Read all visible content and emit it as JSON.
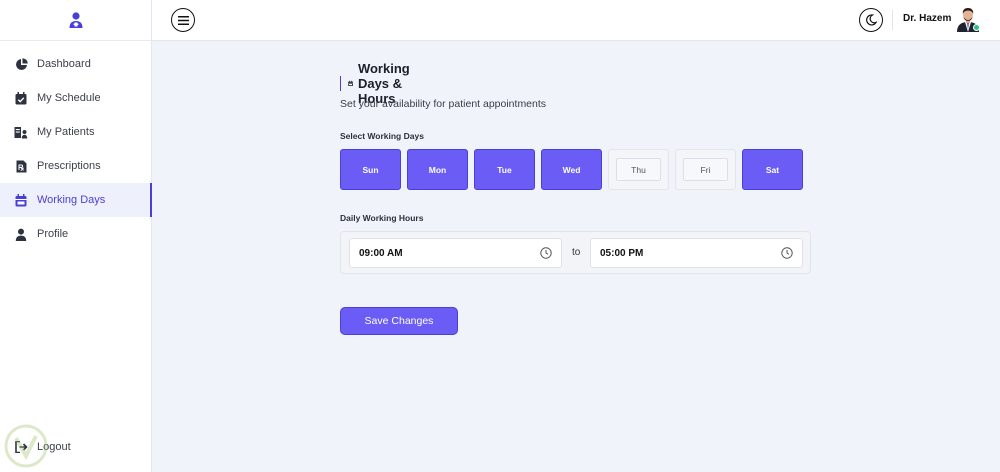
{
  "sidebar": {
    "items": [
      {
        "label": "Dashboard",
        "icon": "pie-chart-icon"
      },
      {
        "label": "My Schedule",
        "icon": "calendar-check-icon"
      },
      {
        "label": "My Patients",
        "icon": "patients-icon"
      },
      {
        "label": "Prescriptions",
        "icon": "prescription-icon"
      },
      {
        "label": "Working Days",
        "icon": "calendar-icon",
        "active": true
      },
      {
        "label": "Profile",
        "icon": "user-icon"
      }
    ],
    "logout_label": "Logout"
  },
  "header": {
    "user_name": "Dr. Hazem",
    "status": "online"
  },
  "main": {
    "title": "Working Days & Hours",
    "subtitle": "Set your availability for patient appointments",
    "days_label": "Select Working Days",
    "days": [
      {
        "label": "Sun",
        "selected": true
      },
      {
        "label": "Mon",
        "selected": true
      },
      {
        "label": "Tue",
        "selected": true
      },
      {
        "label": "Wed",
        "selected": true
      },
      {
        "label": "Thu",
        "selected": false
      },
      {
        "label": "Fri",
        "selected": false
      },
      {
        "label": "Sat",
        "selected": true
      }
    ],
    "hours_label": "Daily Working Hours",
    "start_time": "09:00 AM",
    "to_label": "to",
    "end_time": "05:00 PM",
    "save_label": "Save Changes"
  },
  "colors": {
    "accent": "#6a5cf5",
    "accent_dark": "#4a3fd8",
    "online": "#2ec27e"
  }
}
